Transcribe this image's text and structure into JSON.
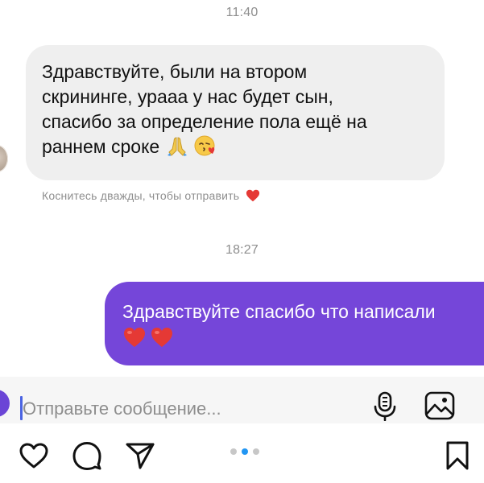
{
  "conversation": {
    "timestamps": [
      "11:40",
      "18:27"
    ],
    "incoming": {
      "text": "Здравствуйте, были на втором\nскрининге, урааа у нас будет сын,\nспасибо за определение пола ещё на\nраннем сроке",
      "emojis": [
        "folded-hands-emoji",
        "face-blowing-kiss-emoji"
      ],
      "hint": "Коснитесь дважды, чтобы отправить"
    },
    "outgoing": {
      "text": "Здравствуйте спасибо что написали",
      "emojis": [
        "red-heart-emoji",
        "red-heart-emoji"
      ]
    }
  },
  "composer": {
    "placeholder": "Отправьте сообщение...",
    "icons": [
      "camera-icon",
      "microphone-icon",
      "gallery-icon"
    ]
  },
  "post_actions": {
    "icons": [
      "heart-icon",
      "comment-icon",
      "share-icon",
      "bookmark-icon"
    ],
    "carousel": {
      "count": 3,
      "active_index": 1,
      "active_color": "#2196f3"
    }
  },
  "colors": {
    "incoming_bubble": "#efefef",
    "outgoing_bubble": "#7546d9",
    "accent_purple": "#6b45d6",
    "heart_red": "#e53935"
  }
}
